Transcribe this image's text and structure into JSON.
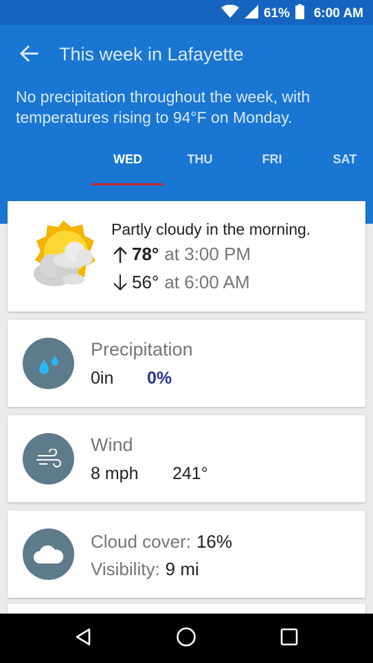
{
  "status_bar": {
    "battery": "61%",
    "time": "6:00 AM",
    "icons": [
      "wifi-icon",
      "signal-icon",
      "battery-icon"
    ]
  },
  "header": {
    "back_icon": "arrow-back-icon",
    "title": "This week in Lafayette",
    "summary": "No precipitation throughout the week, with temperatures rising to 94°F on Monday."
  },
  "tabs": [
    {
      "label": "WED",
      "active": true
    },
    {
      "label": "THU",
      "active": false
    },
    {
      "label": "FRI",
      "active": false
    },
    {
      "label": "SAT",
      "active": false
    }
  ],
  "forecast": {
    "icon": "partly-cloudy-icon",
    "condition": "Partly cloudy in the morning.",
    "high": "78°",
    "high_time": "at 3:00 PM",
    "low": "56°",
    "low_time": "at 6:00 AM"
  },
  "precipitation": {
    "icon": "raindrops-icon",
    "label": "Precipitation",
    "amount": "0in",
    "chance": "0%"
  },
  "wind": {
    "icon": "wind-icon",
    "label": "Wind",
    "speed": "8 mph",
    "direction": "241°"
  },
  "clouds": {
    "icon": "cloud-icon",
    "cover_label": "Cloud cover:",
    "cover_value": "16%",
    "visibility_label": "Visibility:",
    "visibility_value": "9 mi"
  },
  "colors": {
    "header_bg": "#1976d2",
    "status_bg": "#1565c0",
    "tab_indicator": "#c62828",
    "icon_circle": "#5e7b8b",
    "chance_text": "#283593"
  }
}
